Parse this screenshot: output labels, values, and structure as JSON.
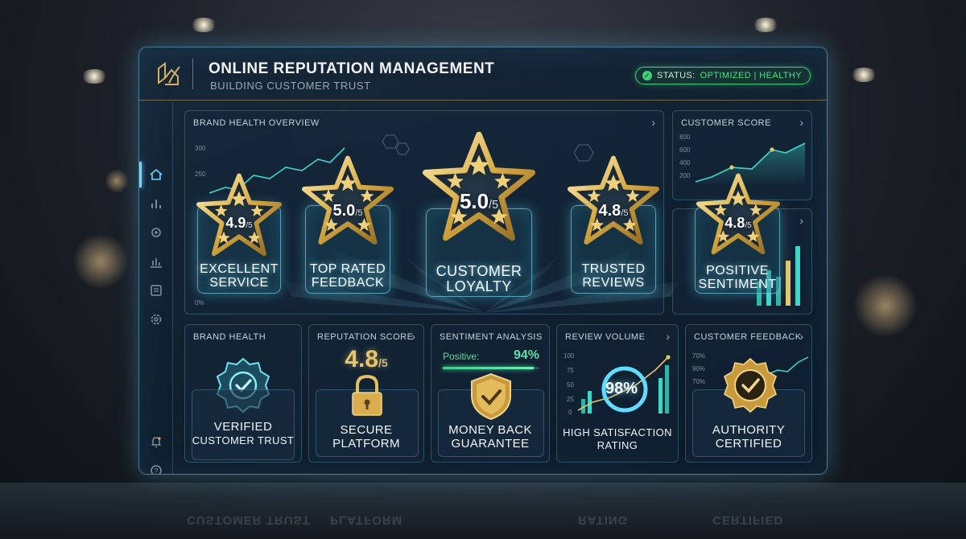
{
  "header": {
    "title": "ONLINE REPUTATION MANAGEMENT",
    "subtitle": "BUILDING CUSTOMER TRUST",
    "status_label": "STATUS:",
    "status_value": "OPTIMIZED | HEALTHY"
  },
  "sidebar": {
    "items": [
      {
        "icon": "home-icon",
        "active": true
      },
      {
        "icon": "bar-chart-icon"
      },
      {
        "icon": "gear-icon"
      },
      {
        "icon": "column-chart-icon"
      },
      {
        "icon": "message-icon"
      },
      {
        "icon": "settings-icon"
      },
      {
        "icon": "bell-icon"
      },
      {
        "icon": "help-icon"
      },
      {
        "icon": "cog-icon"
      }
    ]
  },
  "brand_overview": {
    "title": "BRAND HEALTH OVERVIEW",
    "y_ticks": [
      "300",
      "250",
      "0%"
    ]
  },
  "customer_score": {
    "title": "CUSTOMER SCORE",
    "y_ticks": [
      "800",
      "600",
      "400",
      "200"
    ]
  },
  "star_cards": [
    {
      "rating": "4.9",
      "suffix": "/5",
      "label_1": "EXCELLENT",
      "label_2": "SERVICE"
    },
    {
      "rating": "5.0",
      "suffix": "/5",
      "label_1": "TOP RATED",
      "label_2": "FEEDBACK"
    },
    {
      "rating": "5.0",
      "suffix": "/5",
      "label_1": "CUSTOMER",
      "label_2": "LOYALTY"
    },
    {
      "rating": "4.8",
      "suffix": "/5",
      "label_1": "TRUSTED",
      "label_2": "REVIEWS"
    },
    {
      "rating": "4.8",
      "suffix": "/5",
      "label_1": "POSITIVE",
      "label_2": "SENTIMENT"
    }
  ],
  "bottom_panels": {
    "brand_health": {
      "title": "BRAND HEALTH",
      "label_1": "VERIFIED",
      "label_2": "CUSTOMER TRUST"
    },
    "reputation": {
      "title": "REPUTATION SCORE",
      "score": "4.8",
      "suffix": "/5",
      "label_1": "SECURE",
      "label_2": "PLATFORM"
    },
    "sentiment": {
      "title": "SENTIMENT ANALYSIS",
      "positive_label": "Positive:",
      "positive_pct": "94%",
      "positive_value": 94,
      "label_1": "MONEY BACK",
      "label_2": "GUARANTEE"
    },
    "review_volume": {
      "title": "REVIEW VOLUME",
      "y_ticks": [
        "100",
        "75",
        "50",
        "25",
        "0"
      ],
      "gauge": "98%",
      "gauge_value": 98,
      "label_1": "HIGH SATISFACTION",
      "label_2": "RATING"
    },
    "feedback": {
      "title": "CUSTOMER FEEDBACK",
      "y_ticks": [
        "70%",
        "90%",
        "70%"
      ],
      "label_1": "AUTHORITY",
      "label_2": "CERTIFIED"
    }
  },
  "reflection": [
    "CUSTOMER TRUST",
    "PLATFORM",
    "RATING",
    "CERTIFIED"
  ],
  "colors": {
    "accent": "#6fd6ff",
    "gold": "#e8c56a",
    "status_green": "#3fd07a"
  }
}
